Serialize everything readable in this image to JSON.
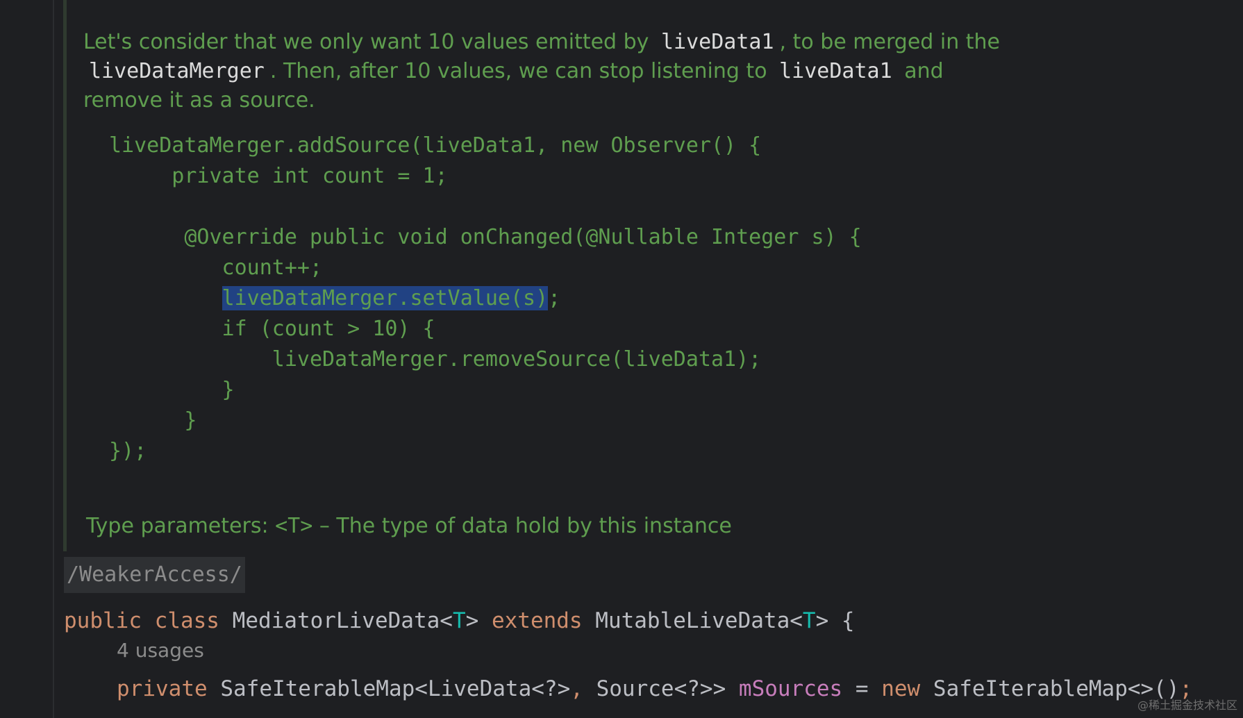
{
  "doc": {
    "p1": "Let's consider that we only want 10 values emitted by",
    "p1_code": "liveData1",
    "p2": ", to be merged in the",
    "p2_code": "liveDataMerger",
    "p3": ". Then, after 10 values, we can stop listening to",
    "p3_code": "liveData1",
    "p4": "and remove it as a source.",
    "code_lines": [
      "liveDataMerger.addSource(liveData1, new Observer() {",
      "     private int count = 1;",
      "",
      "      @Override public void onChanged(@Nullable Integer s) {",
      "         count++;",
      "         liveDataMerger.setValue(s);",
      "         if (count > 10) {",
      "             liveDataMerger.removeSource(liveData1);",
      "         }",
      "      }",
      "});"
    ],
    "highlighted_segment": "liveDataMerger.setValue(s)",
    "type_params_label": "Type parameters:",
    "type_params_param": "<T>",
    "type_params_desc": "– The type of data hold by this instance"
  },
  "code": {
    "inspection_comment": "/WeakerAccess/",
    "class_decl": {
      "kw_public": "public",
      "kw_class": "class",
      "class_name": "MediatorLiveData<",
      "type_param": "T",
      "close_gt": ">",
      "kw_extends": "extends",
      "super_name": "MutableLiveData<",
      "super_tp": "T",
      "tail": "> {"
    },
    "usages": "4 usages",
    "field_decl": {
      "kw_private": "private",
      "type": "SafeIterableMap<LiveData<?>",
      "comma": ",",
      "type2": "Source<?>>",
      "field": "mSources",
      "eq": "=",
      "kw_new": "new",
      "ctor": "SafeIterableMap<>()",
      "semi": ";"
    }
  },
  "watermark": "@稀土掘金技术社区"
}
